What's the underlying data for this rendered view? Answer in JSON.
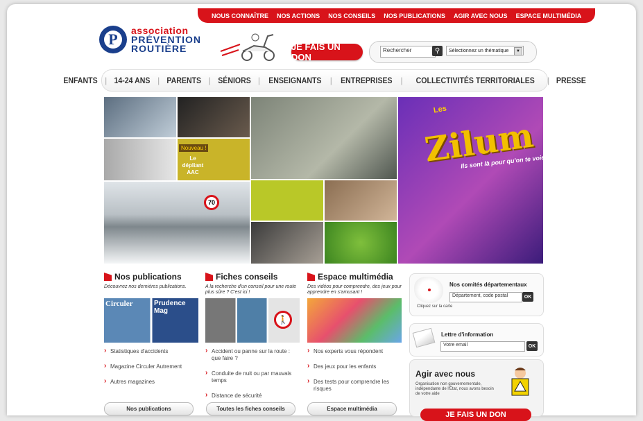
{
  "top_nav": [
    "NOUS CONNAÎTRE",
    "NOS ACTIONS",
    "NOS CONSEILS",
    "NOS PUBLICATIONS",
    "AGIR AVEC NOUS",
    "ESPACE MULTIMÉDIA"
  ],
  "logo": {
    "line1": "association",
    "line2": "PRÉVENTION",
    "line3": "ROUTIÈRE",
    "mark": "P"
  },
  "don_button": "JE FAIS UN DON",
  "search": {
    "placeholder": "Rechercher",
    "theme_select": "Sélectionnez un thématique"
  },
  "main_nav": [
    "ENFANTS",
    "14-24 ANS",
    "PARENTS",
    "SÉNIORS",
    "ENSEIGNANTS",
    "ENTREPRISES",
    "COLLECTIVITÉS TERRITORIALES",
    "PRESSE"
  ],
  "banner": {
    "nouveau": "Nouveau !",
    "depliant": "Le dépliant AAC",
    "speed_sign": "70",
    "zilum_les": "Les",
    "zilum_title": "Zilum",
    "zilum_sub": "Ils sont là pour qu'on te voie !"
  },
  "columns": [
    {
      "title": "Nos publications",
      "desc": "Découvrez nos dernières publications.",
      "img_labels": [
        "Circuler",
        "Prudence Mag"
      ],
      "links": [
        "Statistiques d'accidents",
        "Magazine Circuler Autrement",
        "Autres magazines"
      ],
      "button": "Nos publications"
    },
    {
      "title": "Fiches conseils",
      "desc": "A la recherche d'un conseil pour une route plus sûre ? C'est ici !",
      "links": [
        "Accident ou panne sur la route : que faire ?",
        "Conduite de nuit ou par mauvais temps",
        "Distance de sécurité"
      ],
      "button": "Toutes les fiches conseils"
    },
    {
      "title": "Espace multimédia",
      "desc": "Des vidéos pour comprendre, des jeux pour apprendre en s'amusant !",
      "links": [
        "Nos experts vous répondent",
        "Des jeux pour les enfants",
        "Des tests pour comprendre les risques"
      ],
      "button": "Espace multimédia"
    }
  ],
  "sidebar": {
    "comites": {
      "title": "Nos comités départementaux",
      "placeholder": "Département, code postal",
      "ok": "OK",
      "map_caption": "Cliquez sur la carte"
    },
    "newsletter": {
      "title": "Lettre d'information",
      "placeholder": "Votre email",
      "ok": "OK"
    },
    "agir": {
      "title": "Agir avec nous",
      "text": "Organisation non gouvernementale, indépendante de l'État, nous avons besoin de votre aide",
      "button": "JE FAIS UN DON"
    }
  },
  "colors": {
    "brand_red": "#d8131a",
    "brand_blue": "#1a3f8c"
  }
}
